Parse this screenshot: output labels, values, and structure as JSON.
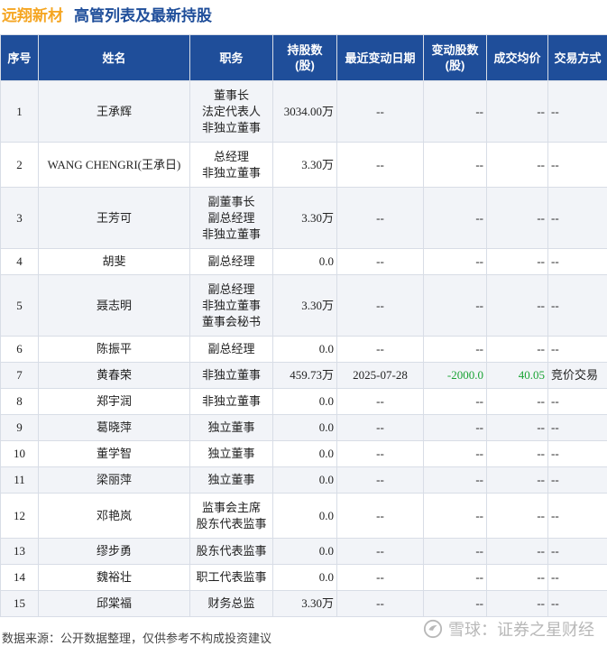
{
  "header": {
    "company": "远翔新材",
    "title": "高管列表及最新持股"
  },
  "columns": [
    "序号",
    "姓名",
    "职务",
    "持股数\n(股)",
    "最近变动日期",
    "变动股数\n(股)",
    "成交均价",
    "交易方式"
  ],
  "rows": [
    {
      "idx": "1",
      "name": "王承辉",
      "pos": [
        "董事长",
        "法定代表人",
        "非独立董事"
      ],
      "shares": "3034.00万",
      "date": "--",
      "chg": "--",
      "price": "--",
      "way": "--"
    },
    {
      "idx": "2",
      "name": "WANG CHENGRI(王承日)",
      "pos": [
        "总经理",
        "非独立董事"
      ],
      "shares": "3.30万",
      "date": "--",
      "chg": "--",
      "price": "--",
      "way": "--"
    },
    {
      "idx": "3",
      "name": "王芳可",
      "pos": [
        "副董事长",
        "副总经理",
        "非独立董事"
      ],
      "shares": "3.30万",
      "date": "--",
      "chg": "--",
      "price": "--",
      "way": "--"
    },
    {
      "idx": "4",
      "name": "胡斐",
      "pos": [
        "副总经理"
      ],
      "shares": "0.0",
      "date": "--",
      "chg": "--",
      "price": "--",
      "way": "--"
    },
    {
      "idx": "5",
      "name": "聂志明",
      "pos": [
        "副总经理",
        "非独立董事",
        "董事会秘书"
      ],
      "shares": "3.30万",
      "date": "--",
      "chg": "--",
      "price": "--",
      "way": "--"
    },
    {
      "idx": "6",
      "name": "陈振平",
      "pos": [
        "副总经理"
      ],
      "shares": "0.0",
      "date": "--",
      "chg": "--",
      "price": "--",
      "way": "--"
    },
    {
      "idx": "7",
      "name": "黄春荣",
      "pos": [
        "非独立董事"
      ],
      "shares": "459.73万",
      "date": "2025-07-28",
      "chg": "-2000.0",
      "price": "40.05",
      "way": "竞价交易"
    },
    {
      "idx": "8",
      "name": "郑宇润",
      "pos": [
        "非独立董事"
      ],
      "shares": "0.0",
      "date": "--",
      "chg": "--",
      "price": "--",
      "way": "--"
    },
    {
      "idx": "9",
      "name": "葛晓萍",
      "pos": [
        "独立董事"
      ],
      "shares": "0.0",
      "date": "--",
      "chg": "--",
      "price": "--",
      "way": "--"
    },
    {
      "idx": "10",
      "name": "董学智",
      "pos": [
        "独立董事"
      ],
      "shares": "0.0",
      "date": "--",
      "chg": "--",
      "price": "--",
      "way": "--"
    },
    {
      "idx": "11",
      "name": "梁丽萍",
      "pos": [
        "独立董事"
      ],
      "shares": "0.0",
      "date": "--",
      "chg": "--",
      "price": "--",
      "way": "--"
    },
    {
      "idx": "12",
      "name": "邓艳岚",
      "pos": [
        "监事会主席",
        "股东代表监事"
      ],
      "shares": "0.0",
      "date": "--",
      "chg": "--",
      "price": "--",
      "way": "--"
    },
    {
      "idx": "13",
      "name": "缪步勇",
      "pos": [
        "股东代表监事"
      ],
      "shares": "0.0",
      "date": "--",
      "chg": "--",
      "price": "--",
      "way": "--"
    },
    {
      "idx": "14",
      "name": "魏裕壮",
      "pos": [
        "职工代表监事"
      ],
      "shares": "0.0",
      "date": "--",
      "chg": "--",
      "price": "--",
      "way": "--"
    },
    {
      "idx": "15",
      "name": "邱棠福",
      "pos": [
        "财务总监"
      ],
      "shares": "3.30万",
      "date": "--",
      "chg": "--",
      "price": "--",
      "way": "--"
    }
  ],
  "footer": {
    "source": "数据来源：公开数据整理，仅供参考不构成投资建议",
    "brand": "雪球：证券之星财经"
  },
  "watermark": "证券之星",
  "colors": {
    "header_bg": "#1f4e9a",
    "company": "#f5a623",
    "down": "#1aa335",
    "up": "#e0241b"
  }
}
